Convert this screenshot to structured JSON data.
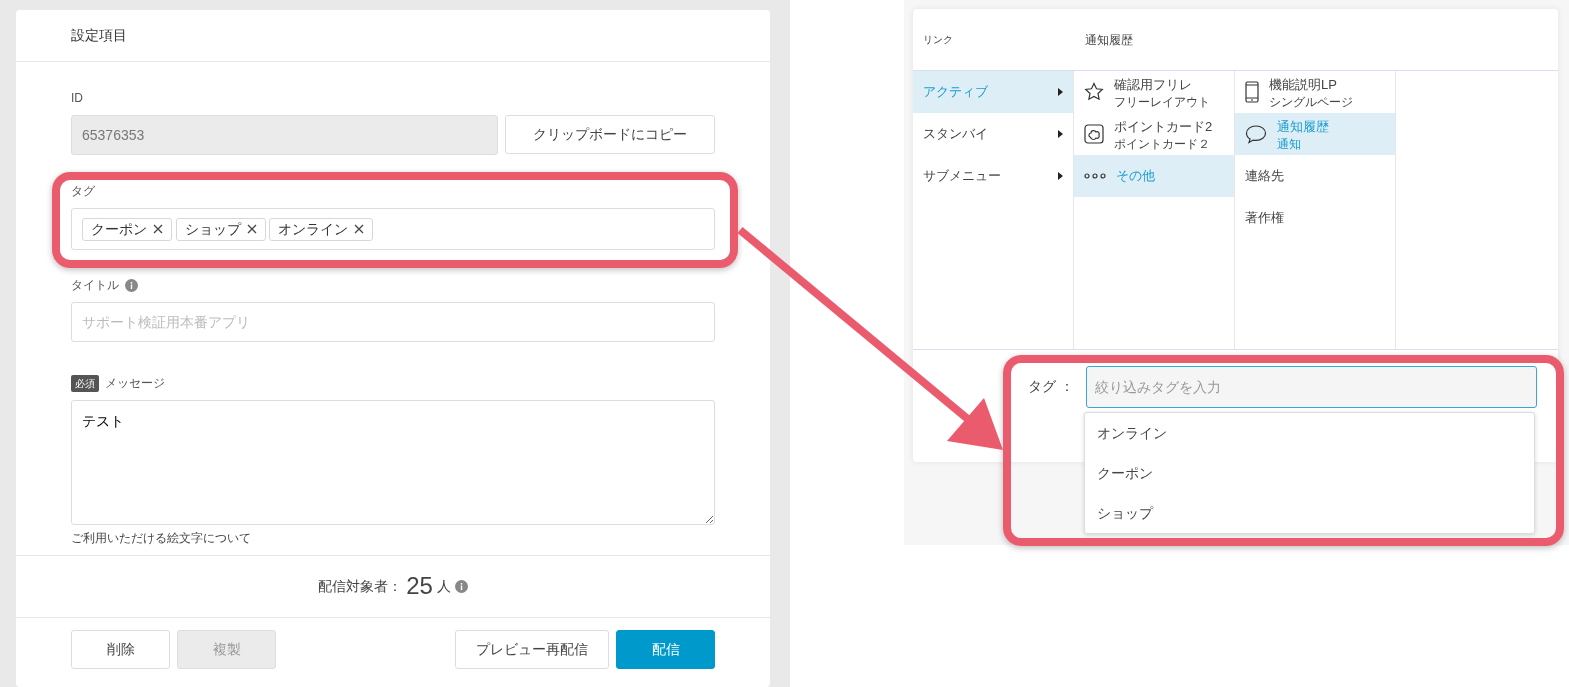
{
  "settings_panel": {
    "title": "設定項目",
    "id_field": {
      "label": "ID",
      "value": "65376353",
      "disabled": true
    },
    "copy_button": "クリップボードにコピー",
    "tag_field": {
      "label": "タグ",
      "tags": [
        "クーポン",
        "ショップ",
        "オンライン"
      ]
    },
    "title_field": {
      "label": "タイトル",
      "placeholder": "サポート検証用本番アプリ"
    },
    "message_field": {
      "required_badge": "必須",
      "label": "メッセージ",
      "value": "テスト",
      "note": "ご利用いただける絵文字について"
    },
    "audience": {
      "label": "配信対象者：",
      "count": "25",
      "unit": "人"
    },
    "buttons": [
      {
        "label": "削除",
        "kind": "secondary",
        "disabled": false
      },
      {
        "label": "複製",
        "kind": "secondary",
        "disabled": true
      },
      {
        "label": "プレビュー再配信",
        "kind": "secondary",
        "disabled": false
      },
      {
        "label": "配信",
        "kind": "primary",
        "disabled": false
      }
    ]
  },
  "link_dialog": {
    "header": {
      "label": "リンク",
      "value": "通知履歴"
    },
    "menu_columns": [
      [
        {
          "label": "アクティブ",
          "has_submenu": true,
          "selected": true
        },
        {
          "label": "スタンバイ",
          "has_submenu": true,
          "selected": false
        },
        {
          "label": "サブメニュー",
          "has_submenu": true,
          "selected": false
        }
      ],
      [
        {
          "label": "確認用フリレ",
          "sublabel": "フリーレイアウト",
          "selected": false
        },
        {
          "label": "ポイントカード2",
          "sublabel": "ポイントカード２",
          "selected": false
        },
        {
          "label": "その他",
          "selected": true
        }
      ],
      [
        {
          "label": "機能説明LP",
          "sublabel": "シングルページ",
          "selected": false
        },
        {
          "label": "通知履歴",
          "sublabel": "通知",
          "selected": true
        },
        {
          "label": "連絡先",
          "selected": false
        },
        {
          "label": "著作権",
          "selected": false
        }
      ]
    ],
    "tag_filter": {
      "label": "タグ ：",
      "placeholder": "絞り込みタグを入力",
      "suggestions": [
        "オンライン",
        "クーポン",
        "ショップ"
      ]
    }
  }
}
